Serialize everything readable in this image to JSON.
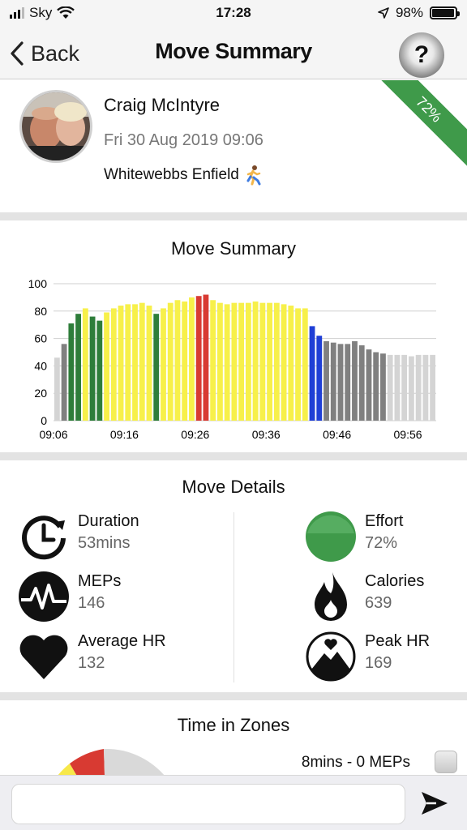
{
  "status_bar": {
    "carrier": "Sky",
    "time": "17:28",
    "battery": "98%",
    "battery_level": 0.98
  },
  "nav": {
    "back_label": "Back",
    "title": "Move Summary",
    "help_label": "?"
  },
  "profile": {
    "name": "Craig McIntyre",
    "date": "Fri 30 Aug 2019 09:06",
    "location": "Whitewebbs Enfield",
    "activity_icon": "runner-icon",
    "effort_badge": "72%"
  },
  "summary": {
    "title": "Move Summary"
  },
  "chart_data": {
    "type": "bar",
    "title": "Move Summary",
    "xlabel": "",
    "ylabel": "",
    "ylim": [
      0,
      100
    ],
    "y_ticks": [
      "0",
      "20",
      "40",
      "60",
      "80",
      "100"
    ],
    "x_ticks": [
      "09:06",
      "09:16",
      "09:26",
      "09:36",
      "09:46",
      "09:56"
    ],
    "grid": true,
    "values": [
      46,
      56,
      71,
      78,
      82,
      76,
      73,
      79,
      82,
      84,
      85,
      85,
      86,
      84,
      78,
      82,
      86,
      88,
      87,
      90,
      91,
      92,
      88,
      86,
      85,
      86,
      86,
      86,
      87,
      86,
      86,
      86,
      85,
      84,
      82,
      82,
      69,
      62,
      58,
      57,
      56,
      56,
      58,
      55,
      52,
      50,
      49,
      48,
      48,
      48,
      47,
      48,
      48,
      48
    ],
    "colors": [
      "#d4d4d4",
      "#808080",
      "#2e7d3a",
      "#2e7d3a",
      "#f7f04a",
      "#2e7d3a",
      "#2e7d3a",
      "#f7f04a",
      "#f7f04a",
      "#f7f04a",
      "#f7f04a",
      "#f7f04a",
      "#f7f04a",
      "#f7f04a",
      "#2e7d3a",
      "#f7f04a",
      "#f7f04a",
      "#f7f04a",
      "#f7f04a",
      "#f7f04a",
      "#d83a32",
      "#d83a32",
      "#f7f04a",
      "#f7f04a",
      "#f7f04a",
      "#f7f04a",
      "#f7f04a",
      "#f7f04a",
      "#f7f04a",
      "#f7f04a",
      "#f7f04a",
      "#f7f04a",
      "#f7f04a",
      "#f7f04a",
      "#f7f04a",
      "#f7f04a",
      "#1f3fd6",
      "#1f3fd6",
      "#808080",
      "#808080",
      "#808080",
      "#808080",
      "#808080",
      "#808080",
      "#808080",
      "#808080",
      "#808080",
      "#d4d4d4",
      "#d4d4d4",
      "#d4d4d4",
      "#d4d4d4",
      "#d4d4d4",
      "#d4d4d4",
      "#d4d4d4"
    ]
  },
  "details": {
    "title": "Move Details",
    "duration": {
      "label": "Duration",
      "value": "53mins",
      "icon": "stopwatch-icon"
    },
    "meps": {
      "label": "MEPs",
      "value": "146",
      "icon": "heartbeat-icon"
    },
    "average_hr": {
      "label": "Average HR",
      "value": "132",
      "icon": "heart-icon"
    },
    "effort": {
      "label": "Effort",
      "value": "72%",
      "icon": "effort-circle-icon",
      "color": "#3f9a4a"
    },
    "calories": {
      "label": "Calories",
      "value": "639",
      "icon": "flame-icon"
    },
    "peak_hr": {
      "label": "Peak HR",
      "value": "169",
      "icon": "mountain-heart-icon"
    }
  },
  "zones": {
    "title": "Time in Zones",
    "legend_first": "8mins - 0 MEPs",
    "colors": {
      "yellow": "#f7e84a",
      "red": "#d83a32",
      "grey": "#d9d9d9"
    }
  },
  "composer": {
    "placeholder": ""
  },
  "colors": {
    "accent_green": "#3f9a4a",
    "divider": "#e3e3e3"
  }
}
